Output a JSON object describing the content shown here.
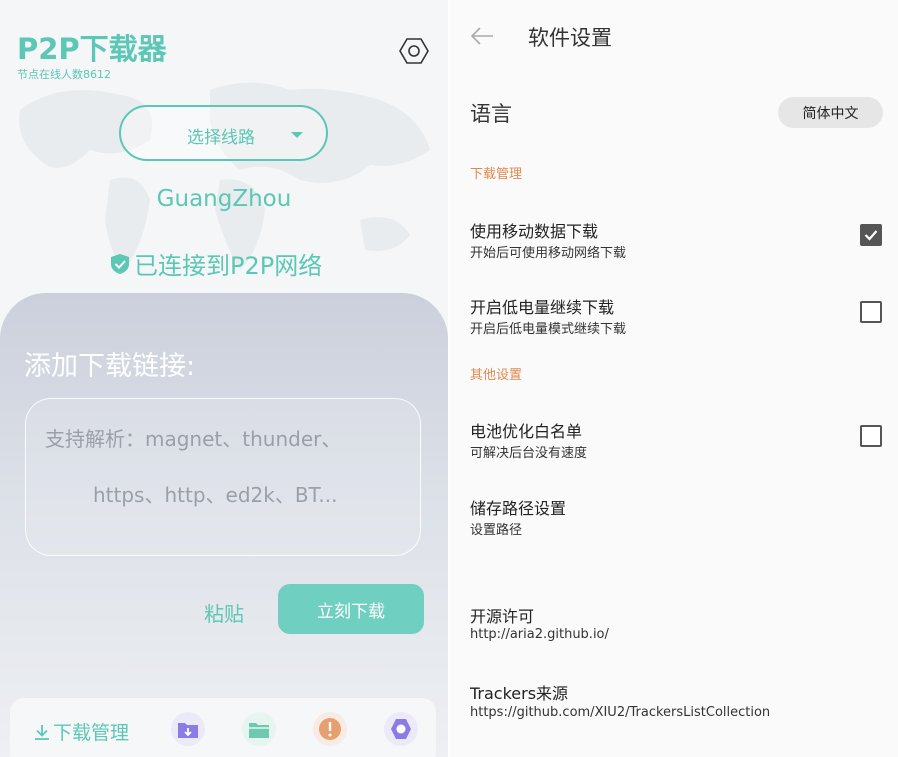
{
  "left": {
    "app_title": "P2P下载器",
    "online_count": "节点在线人数8612",
    "route_button": "选择线路",
    "city": "GuangZhou",
    "connection_status": "已连接到P2P网络",
    "add_link_title": "添加下载链接:",
    "input_placeholder_line1": "支持解析：magnet、thunder、",
    "input_placeholder_line2": "https、http、ed2k、BT...",
    "paste_button": "粘贴",
    "download_now_button": "立刻下载",
    "bottom_nav": {
      "download_manager": "下载管理",
      "icons": [
        "folder-download-icon",
        "folder-icon",
        "info-alert-icon",
        "settings-ring-icon"
      ]
    }
  },
  "right": {
    "title": "软件设置",
    "language": {
      "label": "语言",
      "value": "简体中文"
    },
    "sections": {
      "download_management": "下载管理",
      "other_settings": "其他设置"
    },
    "items": [
      {
        "title": "使用移动数据下载",
        "subtitle": "开始后可使用移动网络下载",
        "checked": true
      },
      {
        "title": "开启低电量继续下载",
        "subtitle": "开启后低电量模式继续下载",
        "checked": false
      },
      {
        "title": "电池优化白名单",
        "subtitle": "可解决后台没有速度",
        "checked": false
      },
      {
        "title": "储存路径设置",
        "subtitle": "设置路径"
      },
      {
        "title": "开源许可",
        "subtitle": "http://aria2.github.io/"
      },
      {
        "title": "Trackers来源",
        "subtitle": "https://github.com/XIU2/TrackersListCollection"
      }
    ]
  },
  "colors": {
    "accent": "#5bc7b4",
    "download_button": "#6fcfc0",
    "section_header": "#e08a50",
    "icon_purple": "#8a7ce6",
    "icon_teal": "#6fc9b0",
    "icon_orange": "#e6a070"
  }
}
